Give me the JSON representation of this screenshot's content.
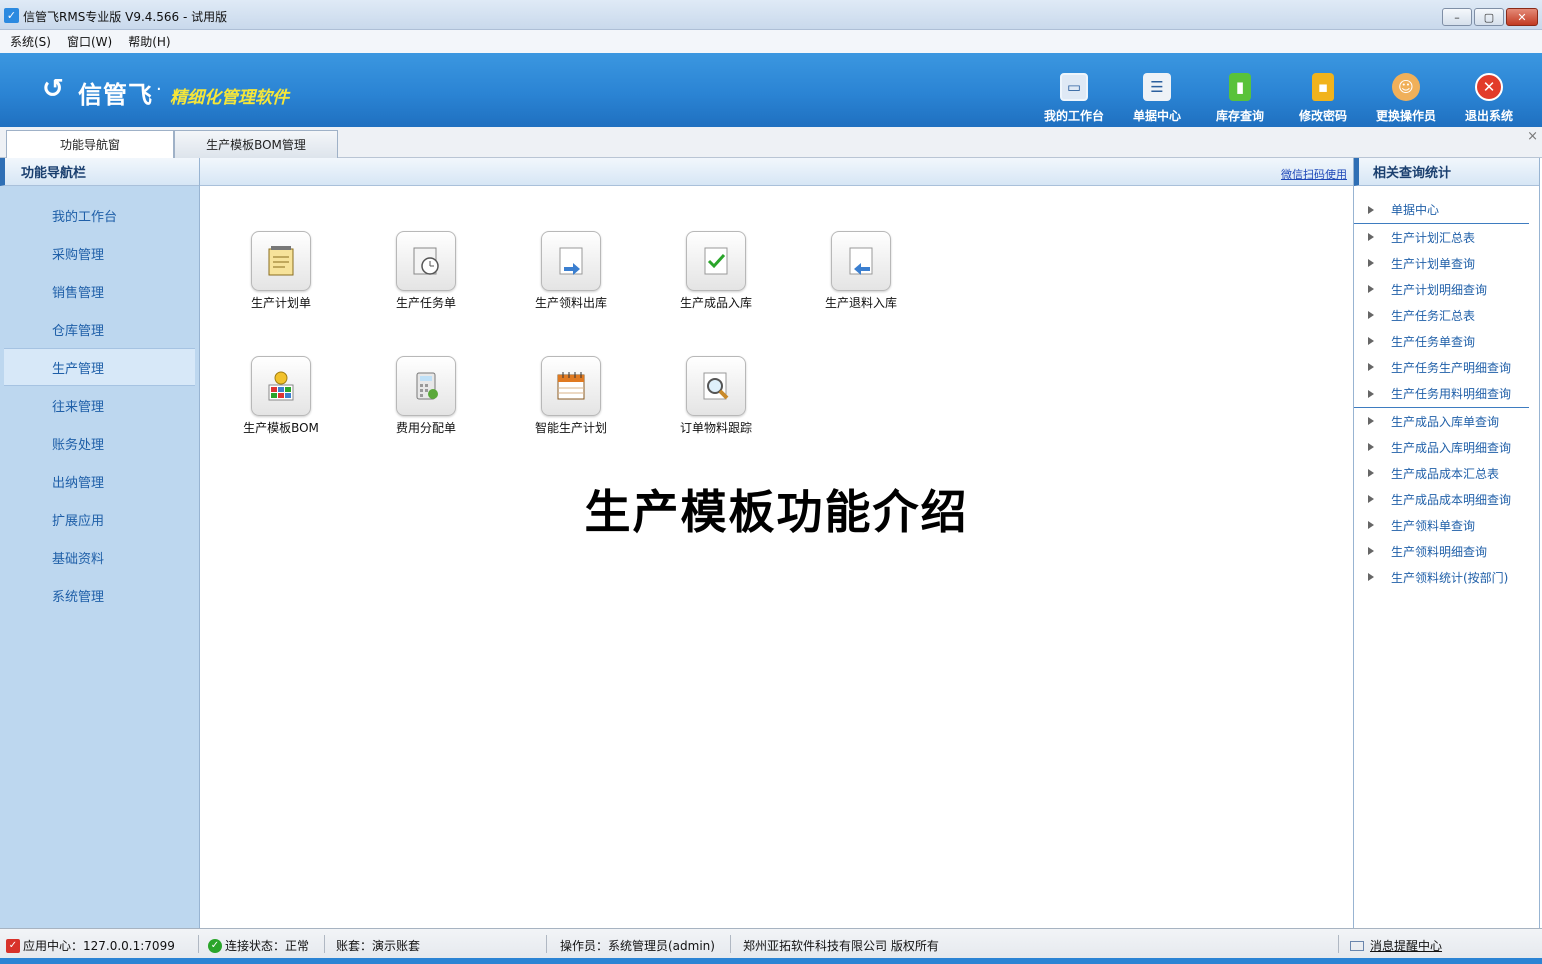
{
  "window": {
    "title": "信管飞RMS专业版 V9.4.566 - 试用版",
    "minimize": "–",
    "maximize": "▢",
    "close": "✕"
  },
  "menu": [
    "系统(S)",
    "窗口(W)",
    "帮助(H)"
  ],
  "brand": {
    "name": "信管飞",
    "dot": "·",
    "slogan": "精细化管理软件"
  },
  "toolbar": [
    {
      "label": "我的工作台",
      "icon": "monitor-icon",
      "color": "#dfe9f5",
      "glyph": "▭"
    },
    {
      "label": "单据中心",
      "icon": "document-list-icon",
      "color": "#eef2f7",
      "glyph": "☰"
    },
    {
      "label": "库存查询",
      "icon": "book-icon",
      "color": "#59c23a",
      "glyph": "▮"
    },
    {
      "label": "修改密码",
      "icon": "lock-icon",
      "color": "#f1b31c",
      "glyph": "🔒"
    },
    {
      "label": "更换操作员",
      "icon": "user-icon",
      "color": "#f0b05a",
      "glyph": "☺"
    },
    {
      "label": "退出系统",
      "icon": "exit-icon",
      "color": "#e23b2a",
      "glyph": "✕"
    }
  ],
  "tabs": {
    "nav": "功能导航窗",
    "bom": "生产模板BOM管理",
    "close": "×"
  },
  "left": {
    "header": "功能导航栏",
    "items": [
      "我的工作台",
      "采购管理",
      "销售管理",
      "仓库管理",
      "生产管理",
      "往来管理",
      "账务处理",
      "出纳管理",
      "扩展应用",
      "基础资料",
      "系统管理"
    ]
  },
  "main": {
    "wechat": "微信扫码使用",
    "functions": [
      {
        "label": "生产计划单",
        "icon": "notepad-icon"
      },
      {
        "label": "生产任务单",
        "icon": "clock-document-icon"
      },
      {
        "label": "生产领料出库",
        "icon": "outbound-arrow-icon"
      },
      {
        "label": "生产成品入库",
        "icon": "check-document-icon"
      },
      {
        "label": "生产退料入库",
        "icon": "return-arrow-icon"
      },
      {
        "label": "生产模板BOM",
        "icon": "bom-gear-icon"
      },
      {
        "label": "费用分配单",
        "icon": "calculator-icon"
      },
      {
        "label": "智能生产计划",
        "icon": "calendar-icon"
      },
      {
        "label": "订单物料跟踪",
        "icon": "magnifier-icon"
      }
    ],
    "intro_title": "生产模板功能介绍"
  },
  "right": {
    "header": "相关查询统计",
    "links": [
      "单据中心",
      "生产计划汇总表",
      "生产计划单查询",
      "生产计划明细查询",
      "生产任务汇总表",
      "生产任务单查询",
      "生产任务生产明细查询",
      "生产任务用料明细查询",
      "生产成品入库单查询",
      "生产成品入库明细查询",
      "生产成品成本汇总表",
      "生产成品成本明细查询",
      "生产领料单查询",
      "生产领料明细查询",
      "生产领料统计(按部门)"
    ]
  },
  "status": {
    "app_center": "应用中心：127.0.0.1:7099",
    "connection": "连接状态：正常",
    "account_set": "账套：演示账套",
    "operator": "操作员：系统管理员(admin)",
    "copyright": "郑州亚拓软件科技有限公司 版权所有",
    "message_center": "消息提醒中心"
  }
}
